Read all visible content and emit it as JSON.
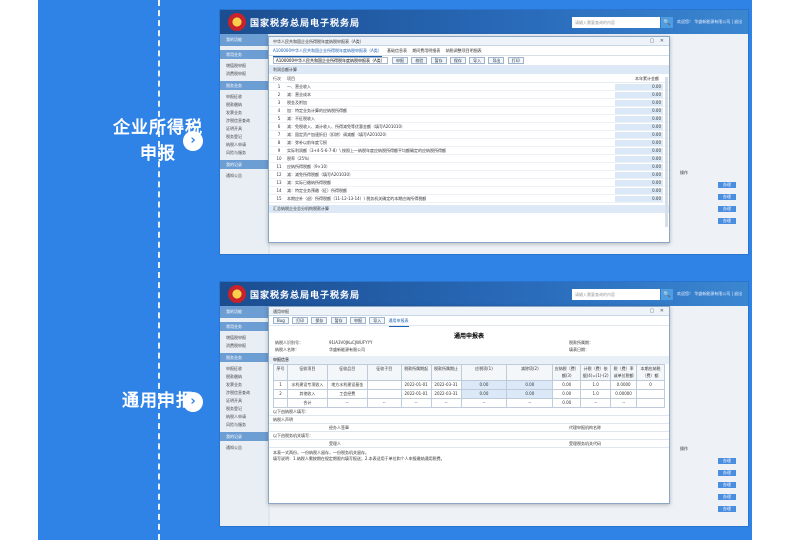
{
  "captions": {
    "first": "企业所得税\n申报",
    "second": "通用申报"
  },
  "arrow_glyph": "›",
  "colors": {
    "background": "#2f82e6",
    "accent": "#1a5fb4"
  },
  "portal": {
    "title": "国家税务总局电子税务局",
    "search_placeholder": "请输入需要查询的内容",
    "search_button": "🔍",
    "userinfo": "欢迎您！ 华盛新能源有限公司 | 退出"
  },
  "sidebar": {
    "home": "我的功能",
    "sections": [
      {
        "head": "常用业务",
        "items": [
          "增值税申报",
          "消费税申报"
        ]
      },
      {
        "head": "税务业务",
        "items": [
          "申报征收",
          "税款缴纳",
          "发票业务",
          "涉税信息查询",
          "证明开具",
          "税务登记",
          "纳税人申请",
          "风险与服务"
        ]
      },
      {
        "head": "我的记录",
        "items": [
          "通知公告"
        ]
      }
    ]
  },
  "back": {
    "header": "操作",
    "button": "办理"
  },
  "form1": {
    "title": "中华人民共和国企业所得税年度纳税申报表（A类）",
    "tabs": [
      "A100000中华人民共和国企业所得税年度纳税申报表（A类）",
      "基础信息表",
      "期间费用明细表",
      "纳税调整项目明细表"
    ],
    "selector": "A100000中华人民共和国企业所得税年度纳税申报表（A类）",
    "toolbar": [
      "申报",
      "校验",
      "暂存",
      "保存",
      "导入",
      "导出",
      "打印"
    ],
    "section": "利润总额计算",
    "col_no": "行次",
    "col_name": "项目",
    "col_amount": "本年累计金额",
    "rows": [
      {
        "no": "1",
        "name": "一、营业收入",
        "amount": "0.00"
      },
      {
        "no": "2",
        "name": "减：营业成本",
        "amount": "0.00"
      },
      {
        "no": "3",
        "name": "税金及附加",
        "amount": "0.00"
      },
      {
        "no": "4",
        "name": "加：特定业务计算的应纳税所得额",
        "amount": "0.00"
      },
      {
        "no": "5",
        "name": "减：不征税收入",
        "amount": "0.00"
      },
      {
        "no": "6",
        "name": "减：免税收入、减计收入、所得减免等优惠金额（填写A201010）",
        "amount": "0.00"
      },
      {
        "no": "7",
        "name": "减：固定资产加速折旧（扣除）调减额（填写A201020）",
        "amount": "0.00"
      },
      {
        "no": "8",
        "name": "减：弥补以前年度亏损",
        "amount": "0.00"
      },
      {
        "no": "9",
        "name": "实际利润额（3+4-5-6-7-8）\\ 按照上一纳税年度应纳税所得额平均额确定的应纳税所得额",
        "amount": "0.00"
      },
      {
        "no": "10",
        "name": "税率（25%）",
        "amount": "0.00"
      },
      {
        "no": "11",
        "name": "应纳所得税额（9×10）",
        "amount": "0.00"
      },
      {
        "no": "12",
        "name": "减：减免所得税额（填写A201030）",
        "amount": "0.00"
      },
      {
        "no": "13",
        "name": "减：实际已缴纳所得税额",
        "amount": "0.00"
      },
      {
        "no": "14",
        "name": "减：特定业务预缴（征）所得税额",
        "amount": "0.00"
      },
      {
        "no": "15",
        "name": "本期应补（退）所得税额（11-12-13-14）\\ 税务机关确定的本期应纳所得税额",
        "amount": "0.00"
      }
    ],
    "footer": "汇总纳税企业总分机构税款计算"
  },
  "form2": {
    "window_title": "通用申报",
    "toolbar": [
      "Bug",
      "打印",
      "保存",
      "暂存",
      "申报",
      "导入"
    ],
    "active_tab": "通用申报表",
    "title": "通用申报表",
    "taxpayer_id_label": "纳税人识别号：",
    "taxpayer_id": "91IA3V0JKuCJWUFYYY",
    "taxpayer_name_label": "纳税人名称：",
    "taxpayer_name": "华盛新能源有限公司",
    "period_label": "税款所属期：",
    "fill_date_label": "填表日期：",
    "section": "申报信息",
    "columns": [
      "序号",
      "征收项目",
      "征收品目",
      "征收子目",
      "税款所属期起",
      "税款所属期止",
      "应税项(1)",
      "减除项(2)",
      "应纳税（费）额(3)",
      "计税（费）依据(4)=(1)-(2)",
      "税（费）率或单位税额(5)",
      "本期应纳税（费）额"
    ],
    "rows": [
      [
        "1",
        "水利建设专项收入",
        "地方水利建设基金",
        "",
        "2022-01-01",
        "2022-03-31",
        "0.00",
        "0.00",
        "0.00",
        "1.0",
        "0.0000",
        "0"
      ],
      [
        "2",
        "其他收入",
        "工会经费",
        "",
        "2022-01-01",
        "2022-03-31",
        "0.00",
        "0.00",
        "0.00",
        "1.0",
        "0.00000",
        ""
      ],
      [
        "",
        "合计",
        "--",
        "--",
        "--",
        "--",
        "--",
        "--",
        "0.00",
        "--",
        "--",
        ""
      ]
    ],
    "signature_label": "以下由纳税人填写：",
    "taxpayer_seal": "纳税人声明",
    "agent_label": "经办人签章",
    "agent_org": "代理申报机构名称",
    "tax_office_label": "以下由税务机关填写：",
    "receiver": "受理人",
    "receiver_org": "受理税务机关代码",
    "notice": "本表一式两份，一份纳税人留存，一份税务机关留存。\n填写说明：1.纳税人需按期在规定期限内填写报送；2.本表适用于单位和个人申报缴纳通用税费。"
  }
}
